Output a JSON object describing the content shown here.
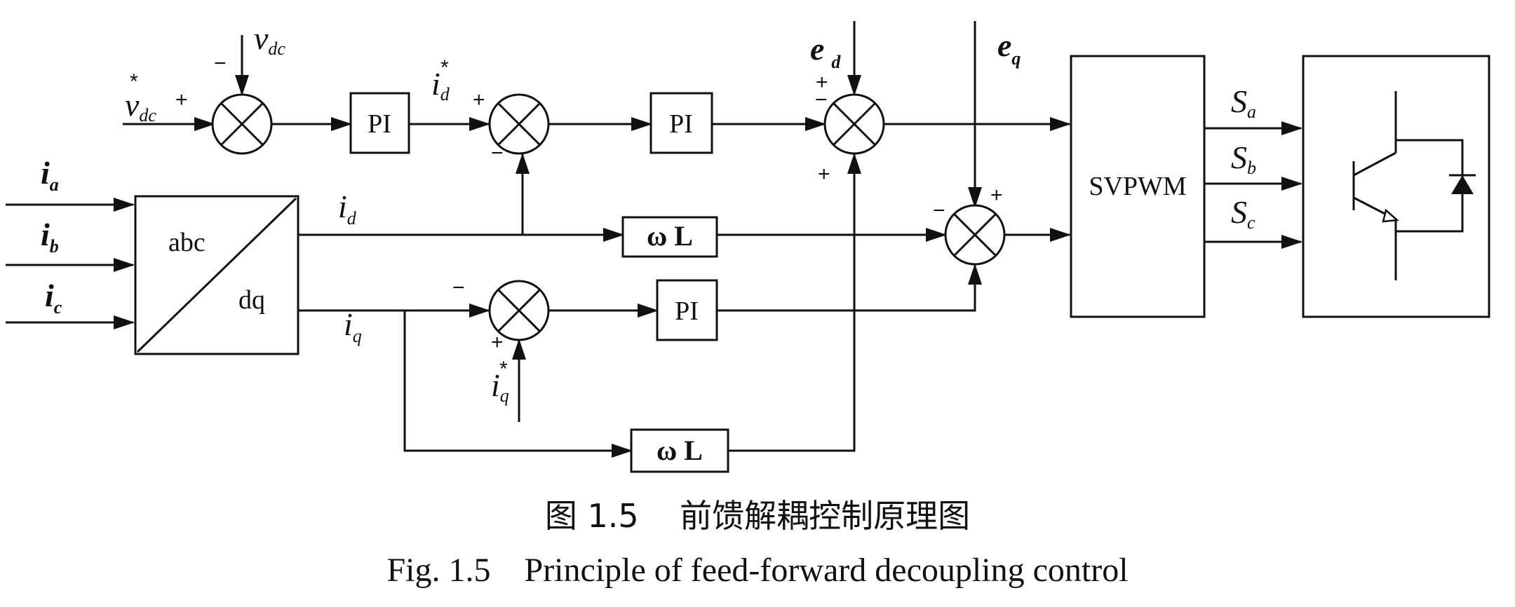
{
  "blocks": {
    "pi": "PI",
    "wl": "ω L",
    "abc": "abc",
    "dq": "dq",
    "svpwm": "SVPWM"
  },
  "signals": {
    "vdc_ref": "v",
    "vdc_ref_sub": "dc",
    "vdc_ref_sup": "*",
    "vdc": "v",
    "vdc_sub": "dc",
    "id_ref": "i",
    "id_ref_sub": "d",
    "id_ref_sup": "*",
    "iq_ref": "i",
    "iq_ref_sub": "q",
    "iq_ref_sup": "*",
    "ia": "i",
    "ia_sub": "a",
    "ib": "i",
    "ib_sub": "b",
    "ic": "i",
    "ic_sub": "c",
    "id": "i",
    "id_sub": "d",
    "iq": "i",
    "iq_sub": "q",
    "ed": "e",
    "ed_sub": "d",
    "eq": "e",
    "eq_sub": "q",
    "sa": "S",
    "sa_sub": "a",
    "sb": "S",
    "sb_sub": "b",
    "sc": "S",
    "sc_sub": "c"
  },
  "signs": {
    "plus": "+",
    "minus": "−"
  },
  "caption": {
    "cn": "图 1.5    前馈解耦控制原理图",
    "en": "Fig. 1.5    Principle of feed-forward decoupling control"
  }
}
